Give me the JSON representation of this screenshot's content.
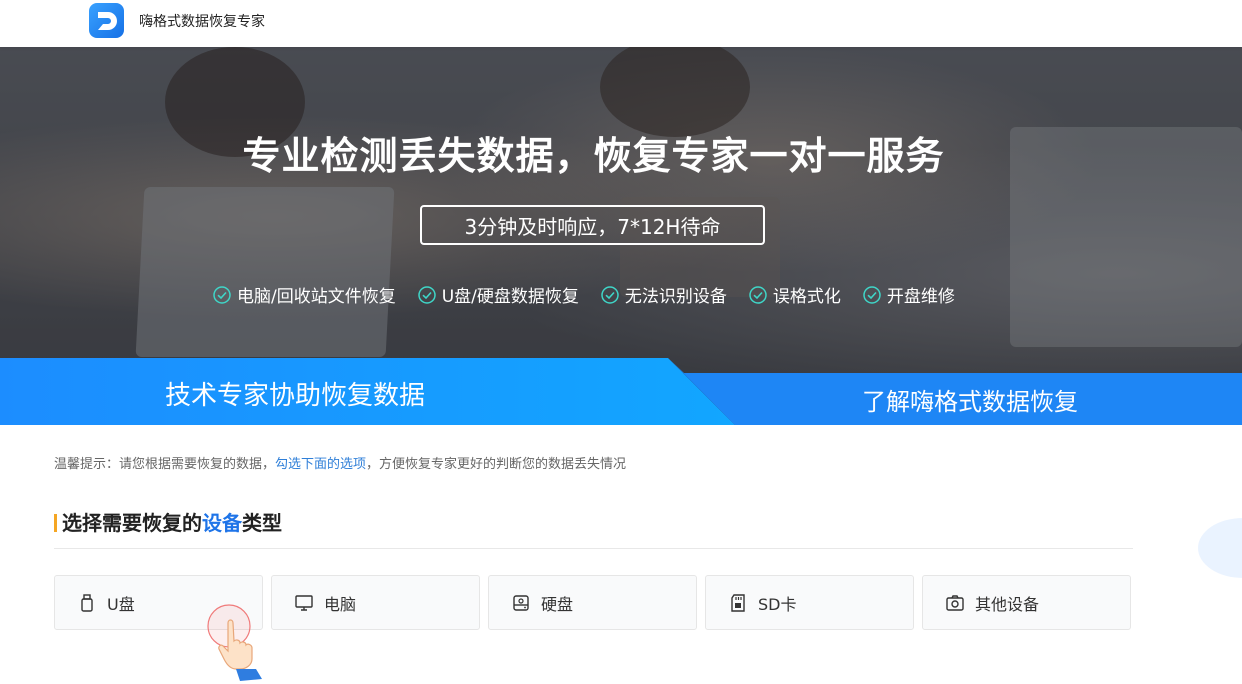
{
  "header": {
    "brand": "嗨格式数据恢复专家",
    "logo_icon": "logo-d-icon"
  },
  "hero": {
    "title": "专业检测丢失数据，恢复专家一对一服务",
    "subtitle": "3分钟及时响应，7*12H待命",
    "features": [
      "电脑/回收站文件恢复",
      "U盘/硬盘数据恢复",
      "无法识别设备",
      "误格式化",
      "开盘维修"
    ]
  },
  "band": {
    "left": "技术专家协助恢复数据",
    "right": "了解嗨格式数据恢复",
    "accent": "#1a8cff"
  },
  "tip": {
    "prefix": "温馨提示：请您根据需要恢复的数据，",
    "link": "勾选下面的选项",
    "suffix": "，方便恢复专家更好的判断您的数据丢失情况"
  },
  "section": {
    "title_a": "选择需要恢复的",
    "title_hl": "设备",
    "title_b": "类型"
  },
  "devices": [
    {
      "label": "U盘",
      "icon": "usb-drive-icon"
    },
    {
      "label": "电脑",
      "icon": "monitor-icon"
    },
    {
      "label": "硬盘",
      "icon": "hard-disk-icon"
    },
    {
      "label": "SD卡",
      "icon": "sd-card-icon"
    },
    {
      "label": "其他设备",
      "icon": "camera-icon"
    }
  ]
}
